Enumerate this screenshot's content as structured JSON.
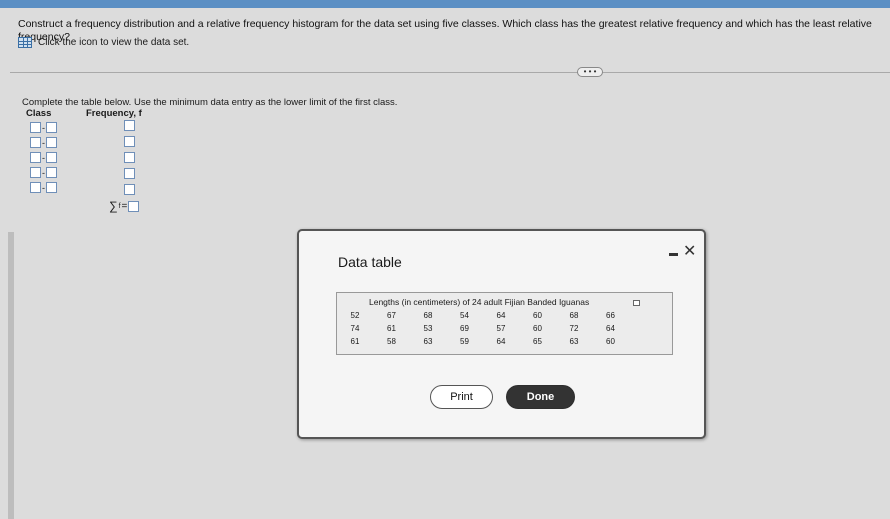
{
  "question": "Construct a frequency distribution and a relative frequency histogram for the data set using five classes. Which class has the greatest relative frequency and which has the least relative frequency?",
  "dataset_link": "Click the icon to view the data set.",
  "more_button": "• • •",
  "instructions": "Complete the table below. Use the minimum data entry as the lower limit of the first class.",
  "table_headers": {
    "class": "Class",
    "frequency": "Frequency, f"
  },
  "sum_label": {
    "symbol": "∑",
    "sub": "f",
    "eq": "="
  },
  "dialog": {
    "title": "Data table",
    "caption": "Lengths (in centimeters) of 24 adult Fijian Banded Iguanas",
    "rows": [
      [
        "52",
        "67",
        "68",
        "54",
        "64",
        "60",
        "68",
        "66"
      ],
      [
        "74",
        "61",
        "53",
        "69",
        "57",
        "60",
        "72",
        "64"
      ],
      [
        "61",
        "58",
        "63",
        "59",
        "64",
        "65",
        "63",
        "60"
      ]
    ],
    "print_label": "Print",
    "done_label": "Done",
    "close_glyph": "✕"
  }
}
